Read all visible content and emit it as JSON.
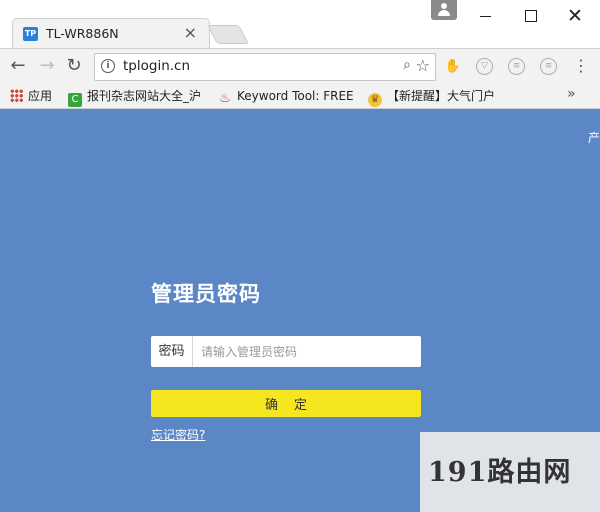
{
  "browser": {
    "tab": {
      "favicon": "TP",
      "title": "TL-WR886N"
    },
    "address_bar": {
      "url": "tplogin.cn"
    },
    "bookmarks": [
      {
        "label": "应用",
        "icon": "apps-grid-icon"
      },
      {
        "label": "报刊杂志网站大全_沪",
        "icon": "green-c-icon"
      },
      {
        "label": "Keyword Tool: FREE",
        "icon": "keyword-tool-icon"
      },
      {
        "label": "【新提醒】大气门户",
        "icon": "trophy-icon"
      }
    ]
  },
  "page": {
    "corner_text": "产",
    "title": "管理员密码",
    "password_label": "密码",
    "password_placeholder": "请输入管理员密码",
    "confirm_label": "确定",
    "forgot_link": "忘记密码?"
  },
  "watermark": {
    "text": "191路由网"
  },
  "colors": {
    "page_background": "#5b87c6",
    "confirm_button": "#f6e61f",
    "chrome_background": "#f2f2f2"
  }
}
